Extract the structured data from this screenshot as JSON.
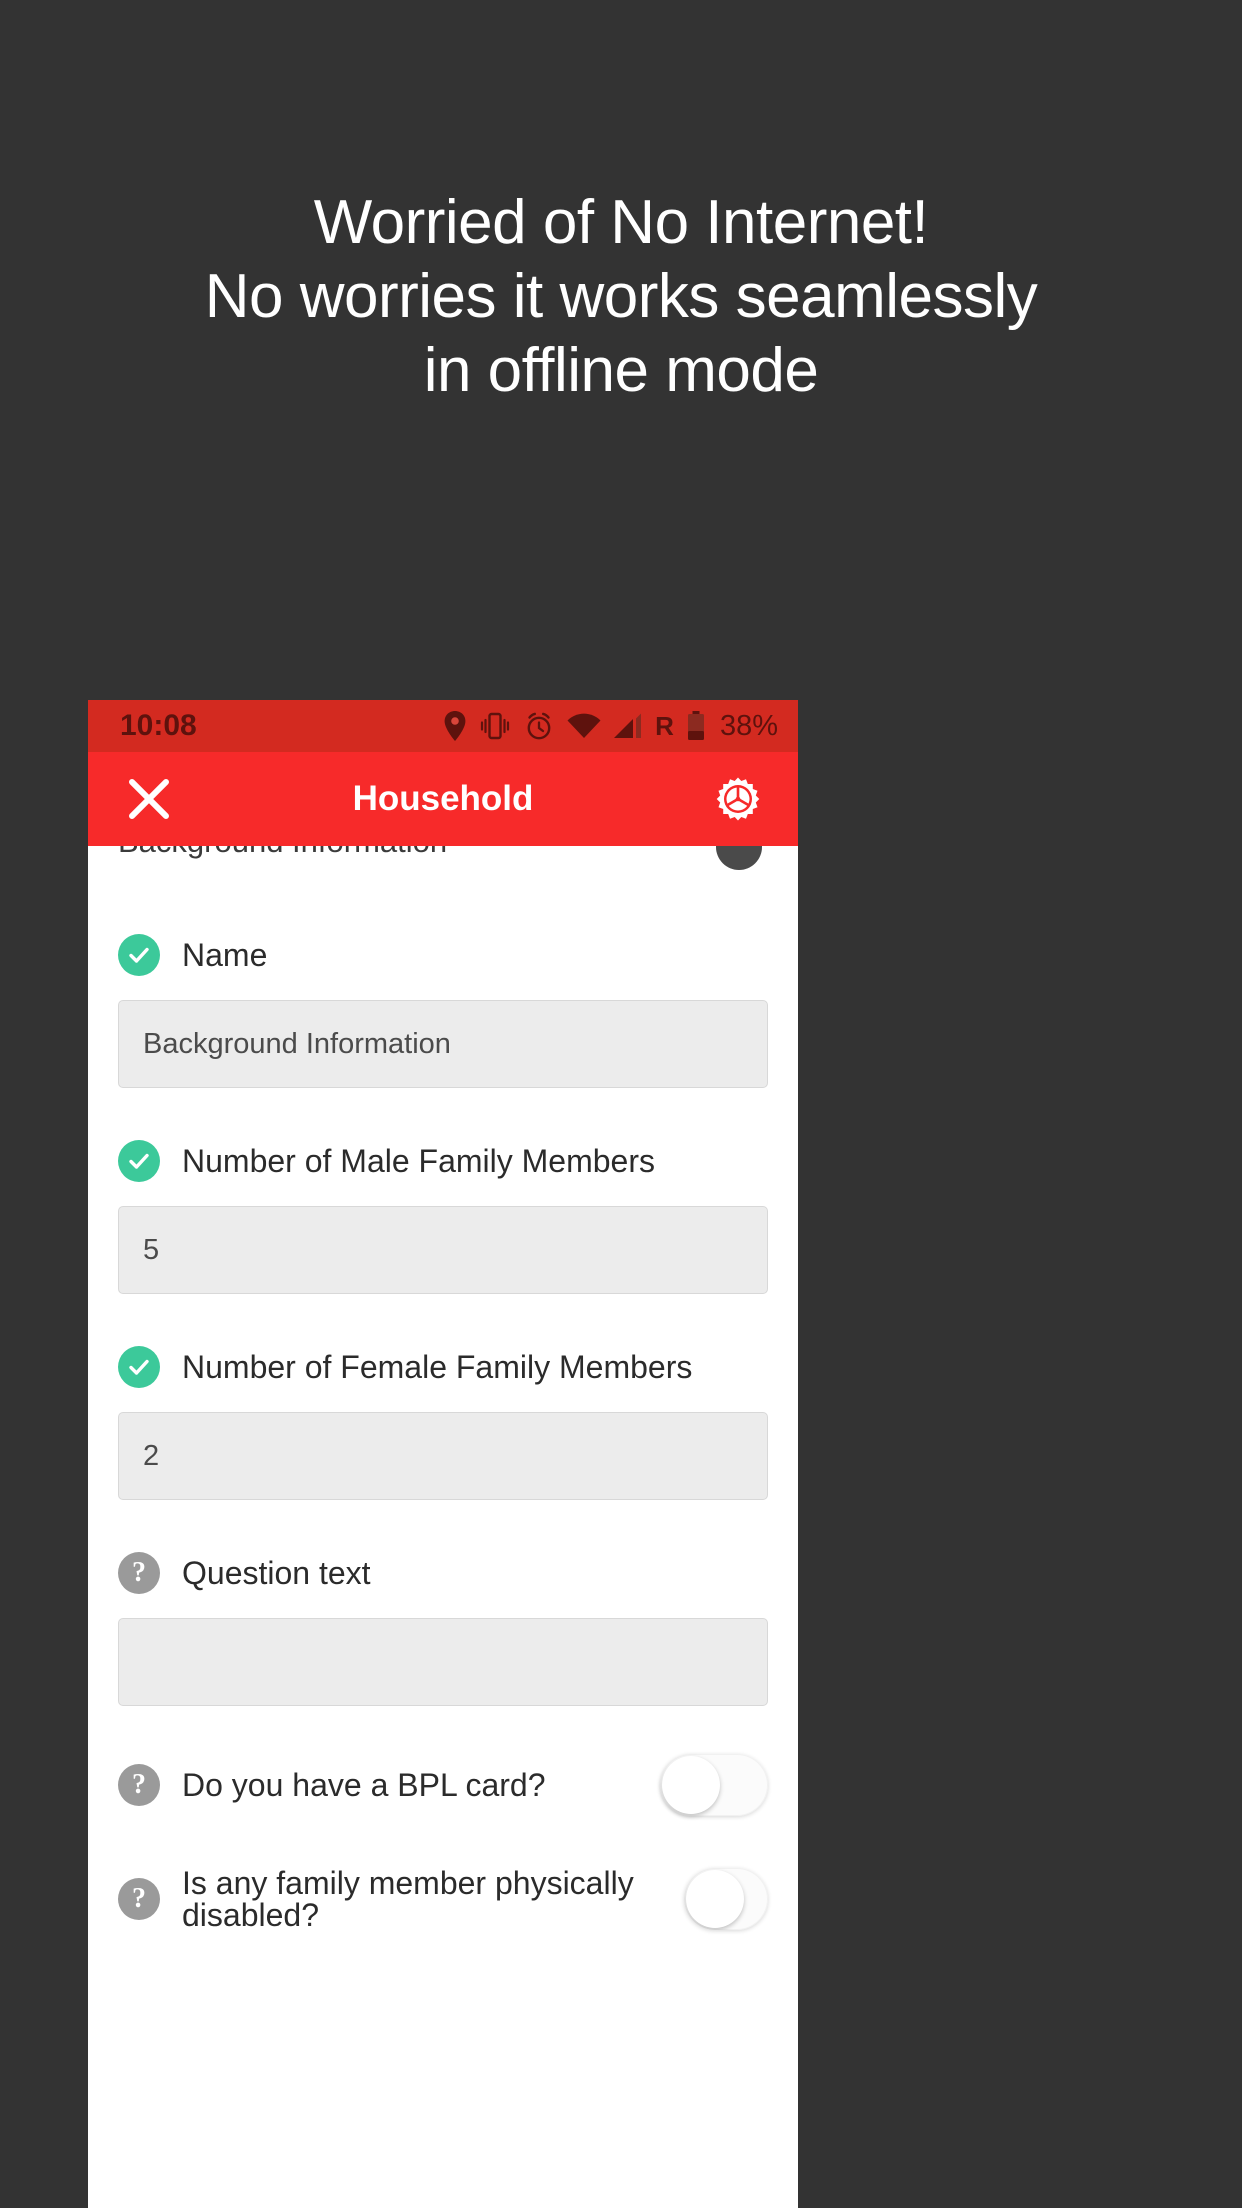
{
  "promo": {
    "headline": "Worried of No Internet!\nNo worries it works seamlessly\nin offline mode"
  },
  "theme": {
    "background": "#333333",
    "statusbar_bg": "#d32a20",
    "appbar_bg": "#f72a2a",
    "accent_green": "#3cc99a",
    "icon_gray": "#9a9a9a",
    "input_bg": "#ececec"
  },
  "statusbar": {
    "time": "10:08",
    "icons": [
      "location-pin-icon",
      "vibrate-icon",
      "alarm-clock-icon",
      "wifi-icon",
      "signal-icon"
    ],
    "roaming_label": "R",
    "battery_percent": "38%"
  },
  "appbar": {
    "close_label": "close-icon",
    "title": "Household",
    "settings_label": "gear-icon"
  },
  "form": {
    "section_header": "Background Information",
    "fields": [
      {
        "status": "check",
        "label": "Name",
        "value": "Background Information",
        "type": "text"
      },
      {
        "status": "check",
        "label": "Number of Male Family Members",
        "value": "5",
        "type": "text"
      },
      {
        "status": "check",
        "label": "Number of Female Family Members",
        "value": "2",
        "type": "text"
      },
      {
        "status": "question",
        "label": "Question text",
        "value": "",
        "type": "text"
      },
      {
        "status": "question",
        "label": "Do you have a BPL card?",
        "value": "off",
        "type": "toggle"
      },
      {
        "status": "question",
        "label": "Is any family member physically disabled?",
        "value": "off",
        "type": "toggle"
      }
    ],
    "question_glyph": "?"
  }
}
